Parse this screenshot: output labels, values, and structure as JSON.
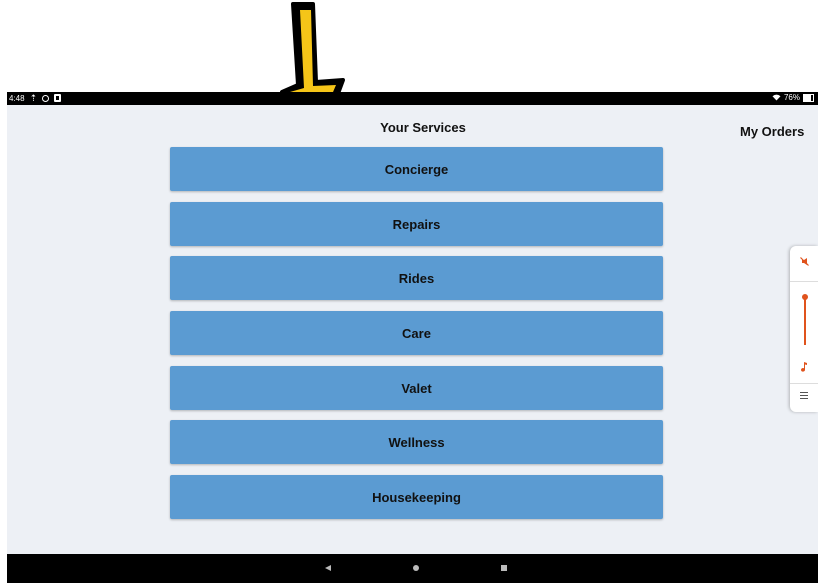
{
  "status_bar": {
    "time": "4:48",
    "battery_percent": "76%"
  },
  "header": {
    "title": "Your Services",
    "orders_label": "My Orders"
  },
  "services": [
    {
      "label": "Concierge"
    },
    {
      "label": "Repairs"
    },
    {
      "label": "Rides"
    },
    {
      "label": "Care"
    },
    {
      "label": "Valet"
    },
    {
      "label": "Wellness"
    },
    {
      "label": "Housekeeping"
    }
  ],
  "colors": {
    "button_bg": "#5b9bd2",
    "screen_bg": "#edf0f5",
    "accent": "#e0531d",
    "arrow_fill": "#f5c518"
  },
  "icons": {
    "status": [
      "upload-arrow-icon",
      "circle-icon",
      "app-icon",
      "wifi-icon",
      "battery-icon"
    ],
    "side_panel": [
      "mute-icon",
      "music-note-icon",
      "settings-icon"
    ],
    "navigation": [
      "back-icon",
      "home-icon",
      "recents-icon"
    ],
    "annotation": "pointer-arrow-icon"
  },
  "volume_level": 1.0
}
